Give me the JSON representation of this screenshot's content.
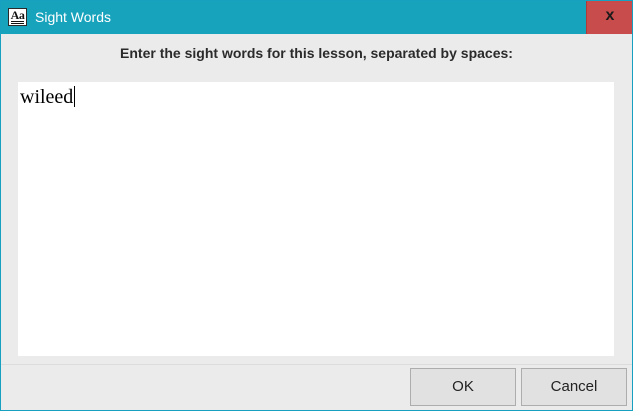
{
  "window": {
    "title": "Sight Words",
    "app_icon": "aa-text-icon",
    "close_label": "x"
  },
  "prompt": "Enter the sight words for this lesson, separated by spaces:",
  "words_input": {
    "value": "wileed"
  },
  "buttons": {
    "ok_label": "OK",
    "cancel_label": "Cancel"
  },
  "colors": {
    "titlebar": "#18a3bd",
    "close_button": "#c94c4c",
    "dialog_background": "#ebebeb"
  }
}
